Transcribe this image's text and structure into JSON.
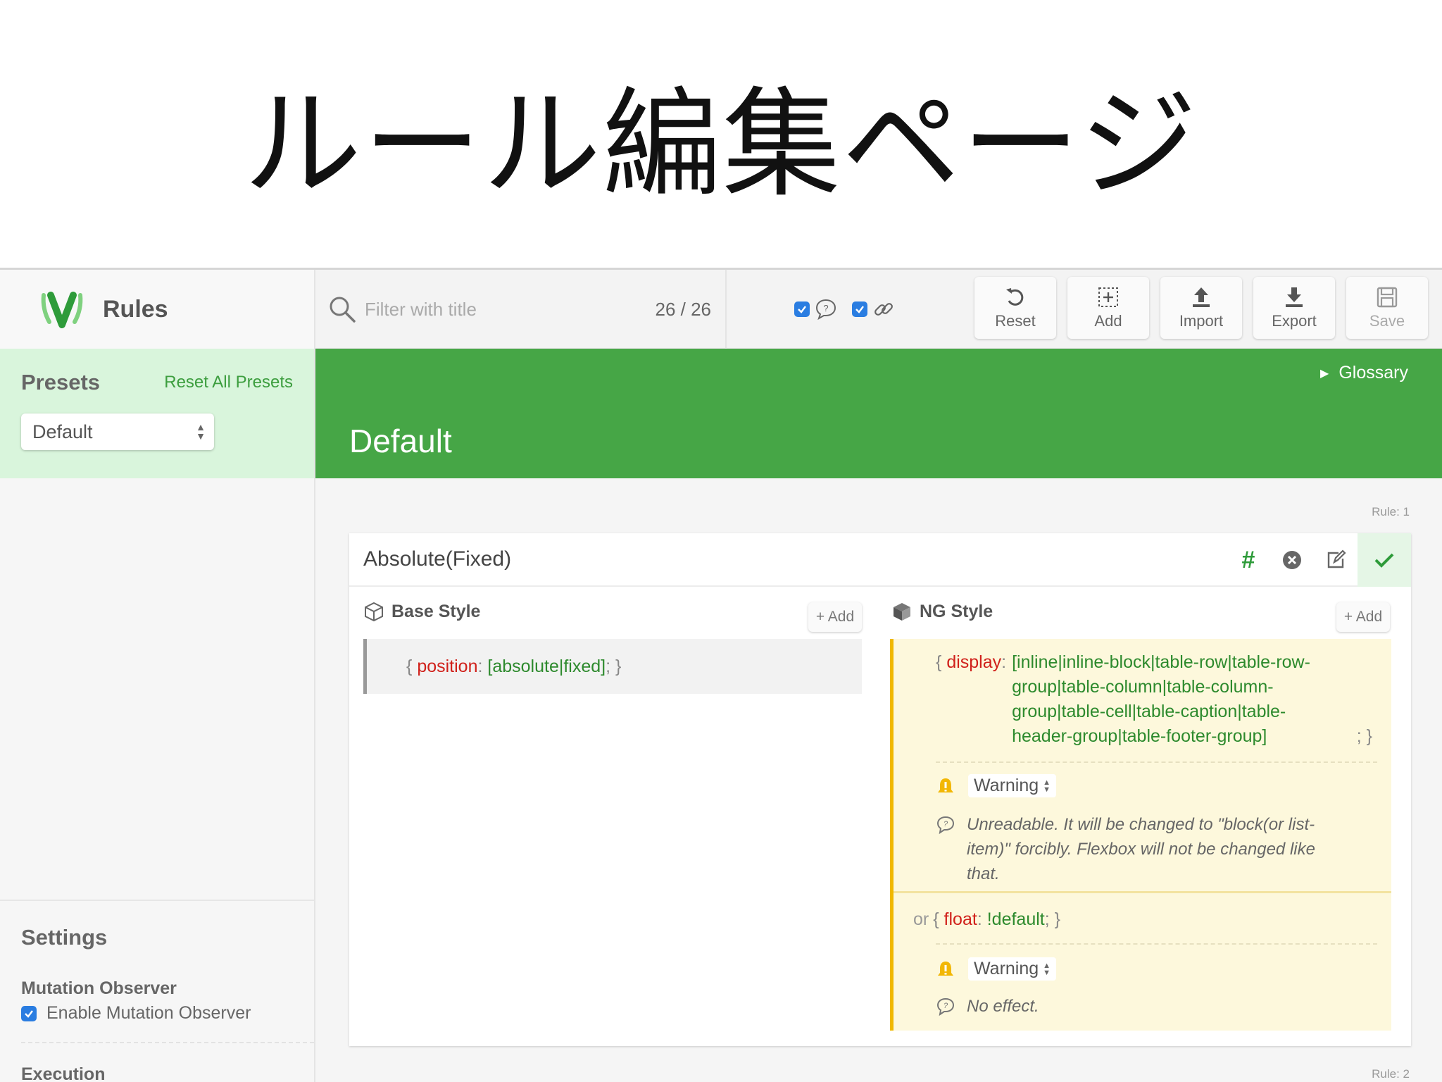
{
  "slide": {
    "title": "ルール編集ページ"
  },
  "sidebar": {
    "app_title": "Rules",
    "presets_title": "Presets",
    "reset_all_presets": "Reset All Presets",
    "preset_selected": "Default",
    "settings_title": "Settings",
    "mutation_observer_title": "Mutation Observer",
    "mutation_observer_label": "Enable Mutation Observer",
    "mutation_observer_checked": true,
    "execution_title": "Execution"
  },
  "toolbar": {
    "search_placeholder": "Filter with title",
    "count": "26 / 26",
    "filter_comments_checked": true,
    "filter_links_checked": true,
    "buttons": {
      "reset": "Reset",
      "add": "Add",
      "import": "Import",
      "export": "Export",
      "save": "Save"
    }
  },
  "header": {
    "glossary": "Glossary",
    "preset_name": "Default"
  },
  "rules": [
    {
      "label": "Rule: 1",
      "title": "Absolute(Fixed)",
      "hash_symbol": "#",
      "base_style": {
        "title": "Base Style",
        "add_label": "+ Add",
        "decl": {
          "open": "{",
          "prop": "position",
          "colon": ":",
          "value": "[absolute|fixed]",
          "close": "; }"
        }
      },
      "ng_style": {
        "title": "NG Style",
        "add_label": "+ Add",
        "items": [
          {
            "open": "{",
            "prop": "display",
            "colon": ":",
            "value": "[inline|inline-block|table-row|table-row-group|table-column|table-column-group|table-cell|table-caption|table-header-group|table-footer-group]",
            "close": "; }",
            "level": "Warning",
            "message": "Unreadable. It will be changed to \"block(or list-item)\" forcibly. Flexbox will not be changed like that."
          },
          {
            "or": "or",
            "open": "{",
            "prop": "float",
            "colon": ":",
            "value": "!default",
            "close": "; }",
            "level": "Warning",
            "message": "No effect."
          }
        ]
      }
    },
    {
      "label": "Rule: 2"
    }
  ],
  "colors": {
    "brand_green": "#46a646",
    "presets_bg": "#d9f5dc",
    "property_red": "#d0201a",
    "value_green": "#2d8a2d",
    "ng_panel_bg": "#fdf8dc",
    "ng_border": "#f0b800",
    "checkbox_blue": "#2a7de1"
  },
  "icons": {
    "logo": "v-logo-icon",
    "search": "search-icon",
    "comment": "comment-icon",
    "link": "link-icon",
    "reset": "undo-icon",
    "add": "add-box-icon",
    "import": "upload-icon",
    "export": "download-icon",
    "save": "save-icon",
    "delete": "close-circle-icon",
    "edit": "edit-icon",
    "check": "check-icon",
    "base_style": "cube-outline-icon",
    "ng_style": "cube-filled-icon",
    "warning": "warning-bell-icon"
  }
}
